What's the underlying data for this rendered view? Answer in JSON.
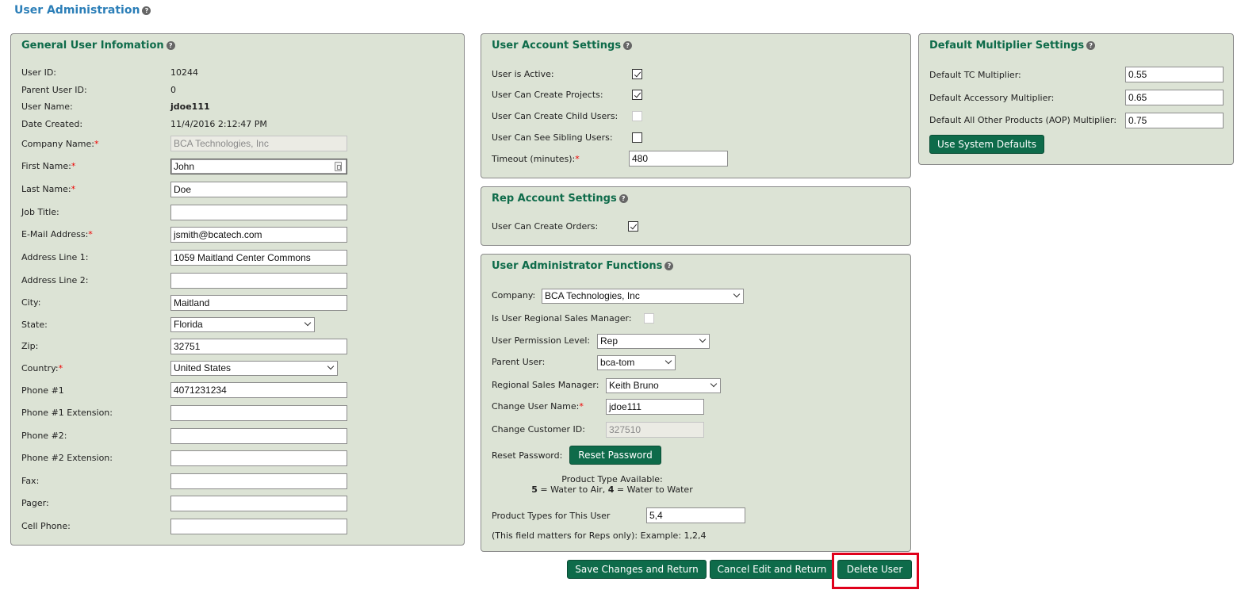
{
  "page": {
    "title": "User Administration"
  },
  "general": {
    "title": "General User Infomation",
    "labels": {
      "user_id": "User ID:",
      "parent_user_id": "Parent User ID:",
      "user_name": "User Name:",
      "date_created": "Date Created:",
      "company_name": "Company Name:",
      "first_name": "First Name:",
      "last_name": "Last Name:",
      "job_title": "Job Title:",
      "email": "E-Mail Address:",
      "address1": "Address Line 1:",
      "address2": "Address Line 2:",
      "city": "City:",
      "state": "State:",
      "zip": "Zip:",
      "country": "Country:",
      "phone1": "Phone #1",
      "phone1_ext": "Phone #1 Extension:",
      "phone2": "Phone #2:",
      "phone2_ext": "Phone #2 Extension:",
      "fax": "Fax:",
      "pager": "Pager:",
      "cell": "Cell Phone:"
    },
    "values": {
      "user_id": "10244",
      "parent_user_id": "0",
      "user_name": "jdoe111",
      "date_created": "11/4/2016 2:12:47 PM",
      "company_name": "BCA Technologies, Inc",
      "first_name": "John",
      "last_name": "Doe",
      "job_title": "",
      "email": "jsmith@bcatech.com",
      "address1": "1059 Maitland Center Commons",
      "address2": "",
      "city": "Maitland",
      "state": "Florida",
      "zip": "32751",
      "country": "United States",
      "phone1": "4071231234",
      "phone1_ext": "",
      "phone2": "",
      "phone2_ext": "",
      "fax": "",
      "pager": "",
      "cell": ""
    }
  },
  "account": {
    "title": "User Account Settings",
    "labels": {
      "active": "User is Active:",
      "create_projects": "User Can Create Projects:",
      "create_child": "User Can Create Child Users:",
      "see_siblings": "User Can See Sibling Users:",
      "timeout": "Timeout (minutes):"
    },
    "checks": {
      "active": true,
      "create_projects": true,
      "create_child": false,
      "see_siblings": false
    },
    "values": {
      "timeout": "480"
    }
  },
  "rep": {
    "title": "Rep Account Settings",
    "labels": {
      "create_orders": "User Can Create Orders:"
    },
    "checks": {
      "create_orders": true
    }
  },
  "admin": {
    "title": "User Administrator Functions",
    "labels": {
      "company": "Company:",
      "regional_mgr_flag": "Is User Regional Sales Manager:",
      "permission": "User Permission Level:",
      "parent_user": "Parent User:",
      "regional_mgr": "Regional Sales Manager:",
      "change_username": "Change User Name:",
      "change_customer_id": "Change Customer ID:",
      "reset_password": "Reset Password:",
      "product_type_available": "Product Type Available:",
      "product_type_5_num": "5",
      "product_type_5_text": " = Water to Air, ",
      "product_type_4_num": "4",
      "product_type_4_text": " = Water to Water",
      "product_types_user": "Product Types for This User",
      "product_types_note": "(This field matters for Reps only): Example: 1,2,4"
    },
    "values": {
      "company": "BCA Technologies, Inc",
      "permission": "Rep",
      "parent_user": "bca-tom",
      "regional_mgr": "Keith Bruno",
      "change_username": "jdoe111",
      "change_customer_id": "327510",
      "product_types": "5,4"
    },
    "reset_button": "Reset Password"
  },
  "multiplier": {
    "title": "Default Multiplier Settings",
    "labels": {
      "tc": "Default TC Multiplier:",
      "accessory": "Default Accessory Multiplier:",
      "aop": "Default All Other Products (AOP) Multiplier:"
    },
    "values": {
      "tc": "0.55",
      "accessory": "0.65",
      "aop": "0.75"
    },
    "defaults_button": "Use System Defaults"
  },
  "actions": {
    "save": "Save Changes and Return",
    "cancel": "Cancel Edit and Return",
    "delete": "Delete User"
  },
  "icons": {
    "help": "help-icon",
    "help_glyph": "?",
    "keyboard": "input-assist-icon"
  },
  "colors": {
    "panel_bg": "#dce3d5",
    "title_green": "#0e6b4a",
    "button_green": "#0e6b4a",
    "page_title_blue": "#2c7fb8",
    "highlight_red": "#e0001b"
  }
}
